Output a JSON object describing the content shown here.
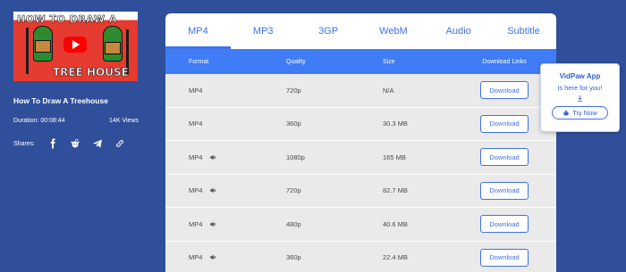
{
  "video": {
    "thumbnail_title_top": "HOW TO DRAW A",
    "thumbnail_title_bottom": "TREE HOUSE",
    "title": "How To Draw A Treehouse",
    "duration": "Duration: 00:08:44",
    "views": "14K Views",
    "shares_label": "Shares:"
  },
  "share_icons": [
    "facebook-icon",
    "reddit-icon",
    "telegram-icon",
    "link-icon"
  ],
  "tabs": [
    {
      "label": "MP4",
      "active": true
    },
    {
      "label": "MP3",
      "active": false
    },
    {
      "label": "3GP",
      "active": false
    },
    {
      "label": "WebM",
      "active": false
    },
    {
      "label": "Audio",
      "active": false
    },
    {
      "label": "Subtitle",
      "active": false
    }
  ],
  "table": {
    "headers": {
      "format": "Format",
      "quality": "Quality",
      "size": "Size",
      "links": "Download Links"
    },
    "rows": [
      {
        "format": "MP4",
        "muted": false,
        "quality": "720p",
        "size": "N/A",
        "button": "Download"
      },
      {
        "format": "MP4",
        "muted": false,
        "quality": "360p",
        "size": "30.3 MB",
        "button": "Download"
      },
      {
        "format": "MP4",
        "muted": true,
        "quality": "1080p",
        "size": "165 MB",
        "button": "Download"
      },
      {
        "format": "MP4",
        "muted": true,
        "quality": "720p",
        "size": "82.7 MB",
        "button": "Download"
      },
      {
        "format": "MP4",
        "muted": true,
        "quality": "480p",
        "size": "40.6 MB",
        "button": "Download"
      },
      {
        "format": "MP4",
        "muted": true,
        "quality": "360p",
        "size": "22.4 MB",
        "button": "Download"
      }
    ]
  },
  "popup": {
    "title": "VidPaw App",
    "subtitle": "is here for you!",
    "button": "Try Now"
  },
  "colors": {
    "background": "#2f4f9b",
    "accent": "#3f71ea",
    "table_header": "#3f7cf5",
    "row_bg": "#eaeaea"
  }
}
